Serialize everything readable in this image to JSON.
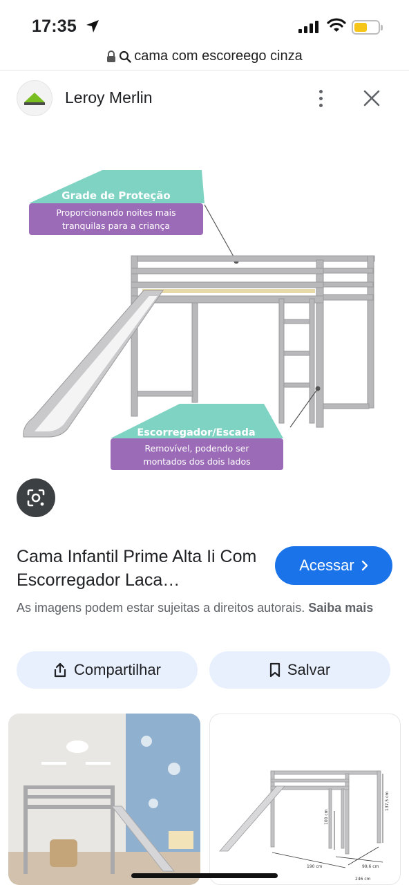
{
  "status": {
    "time": "17:35"
  },
  "url_bar": {
    "query": "cama com escoreego cinza"
  },
  "source": {
    "site_name": "Leroy Merlin"
  },
  "image": {
    "callout_top_title": "Grade de Proteção",
    "callout_top_text_1": "Proporcionando noites mais",
    "callout_top_text_2": "tranquilas para a criança",
    "callout_bottom_title": "Escorregador/Escada",
    "callout_bottom_text_1": "Removível, podendo ser",
    "callout_bottom_text_2": "montados dos dois lados"
  },
  "result": {
    "title": "Cama Infantil Prime Alta Ii Com Escorregador Laca…",
    "access_label": "Acessar",
    "copyright_text": "As imagens podem estar sujeitas a direitos autorais.",
    "learn_more": "Saiba mais"
  },
  "actions": {
    "share_label": "Compartilhar",
    "save_label": "Salvar"
  },
  "related": {
    "dim_width": "190 cm",
    "dim_depth": "99,6 cm",
    "dim_length": "246 cm",
    "dim_height_1": "100 cm",
    "dim_height_2": "137,5 cm"
  },
  "colors": {
    "accent": "#1a73e8",
    "chip_bg": "#e8f0fe",
    "teal": "#7fd3c3",
    "purple": "#9c6bb8"
  }
}
